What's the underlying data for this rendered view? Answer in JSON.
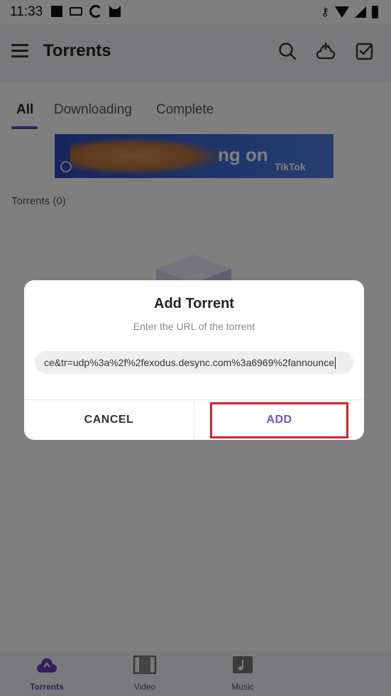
{
  "status_bar": {
    "time": "11:33",
    "icons_left": [
      "square-icon",
      "keyboard-icon",
      "edge-icon",
      "cat-icon"
    ],
    "icons_right": [
      "key-icon",
      "wifi-icon",
      "signal-icon",
      "battery-icon"
    ]
  },
  "app_bar": {
    "title": "Torrents",
    "actions": [
      "search-icon",
      "add-torrent-icon",
      "select-icon"
    ]
  },
  "tabs": [
    {
      "label": "All",
      "selected": true
    },
    {
      "label": "Downloading",
      "selected": false
    },
    {
      "label": "Complete",
      "selected": false
    }
  ],
  "ad": {
    "text": "ng on",
    "brand": "TikTok"
  },
  "torrents_count_label": "Torrents (0)",
  "dialog": {
    "title": "Add Torrent",
    "subtitle": "Enter the URL of the torrent",
    "url_value": "ce&tr=udp%3a%2f%2fexodus.desync.com%3a6969%2fannounce",
    "cancel_label": "CANCEL",
    "add_label": "ADD",
    "highlighted_button": "ADD"
  },
  "bottom_nav": [
    {
      "label": "Torrents",
      "icon": "cloud-upload-icon",
      "selected": true
    },
    {
      "label": "Video",
      "icon": "film-icon",
      "selected": false
    },
    {
      "label": "Music",
      "icon": "music-icon",
      "selected": false
    }
  ],
  "colors": {
    "accent": "#6b3fb8",
    "add_button": "#7a4fd0",
    "highlight_border": "#d4232a",
    "scrim": "rgba(0,0,0,0.5)"
  }
}
